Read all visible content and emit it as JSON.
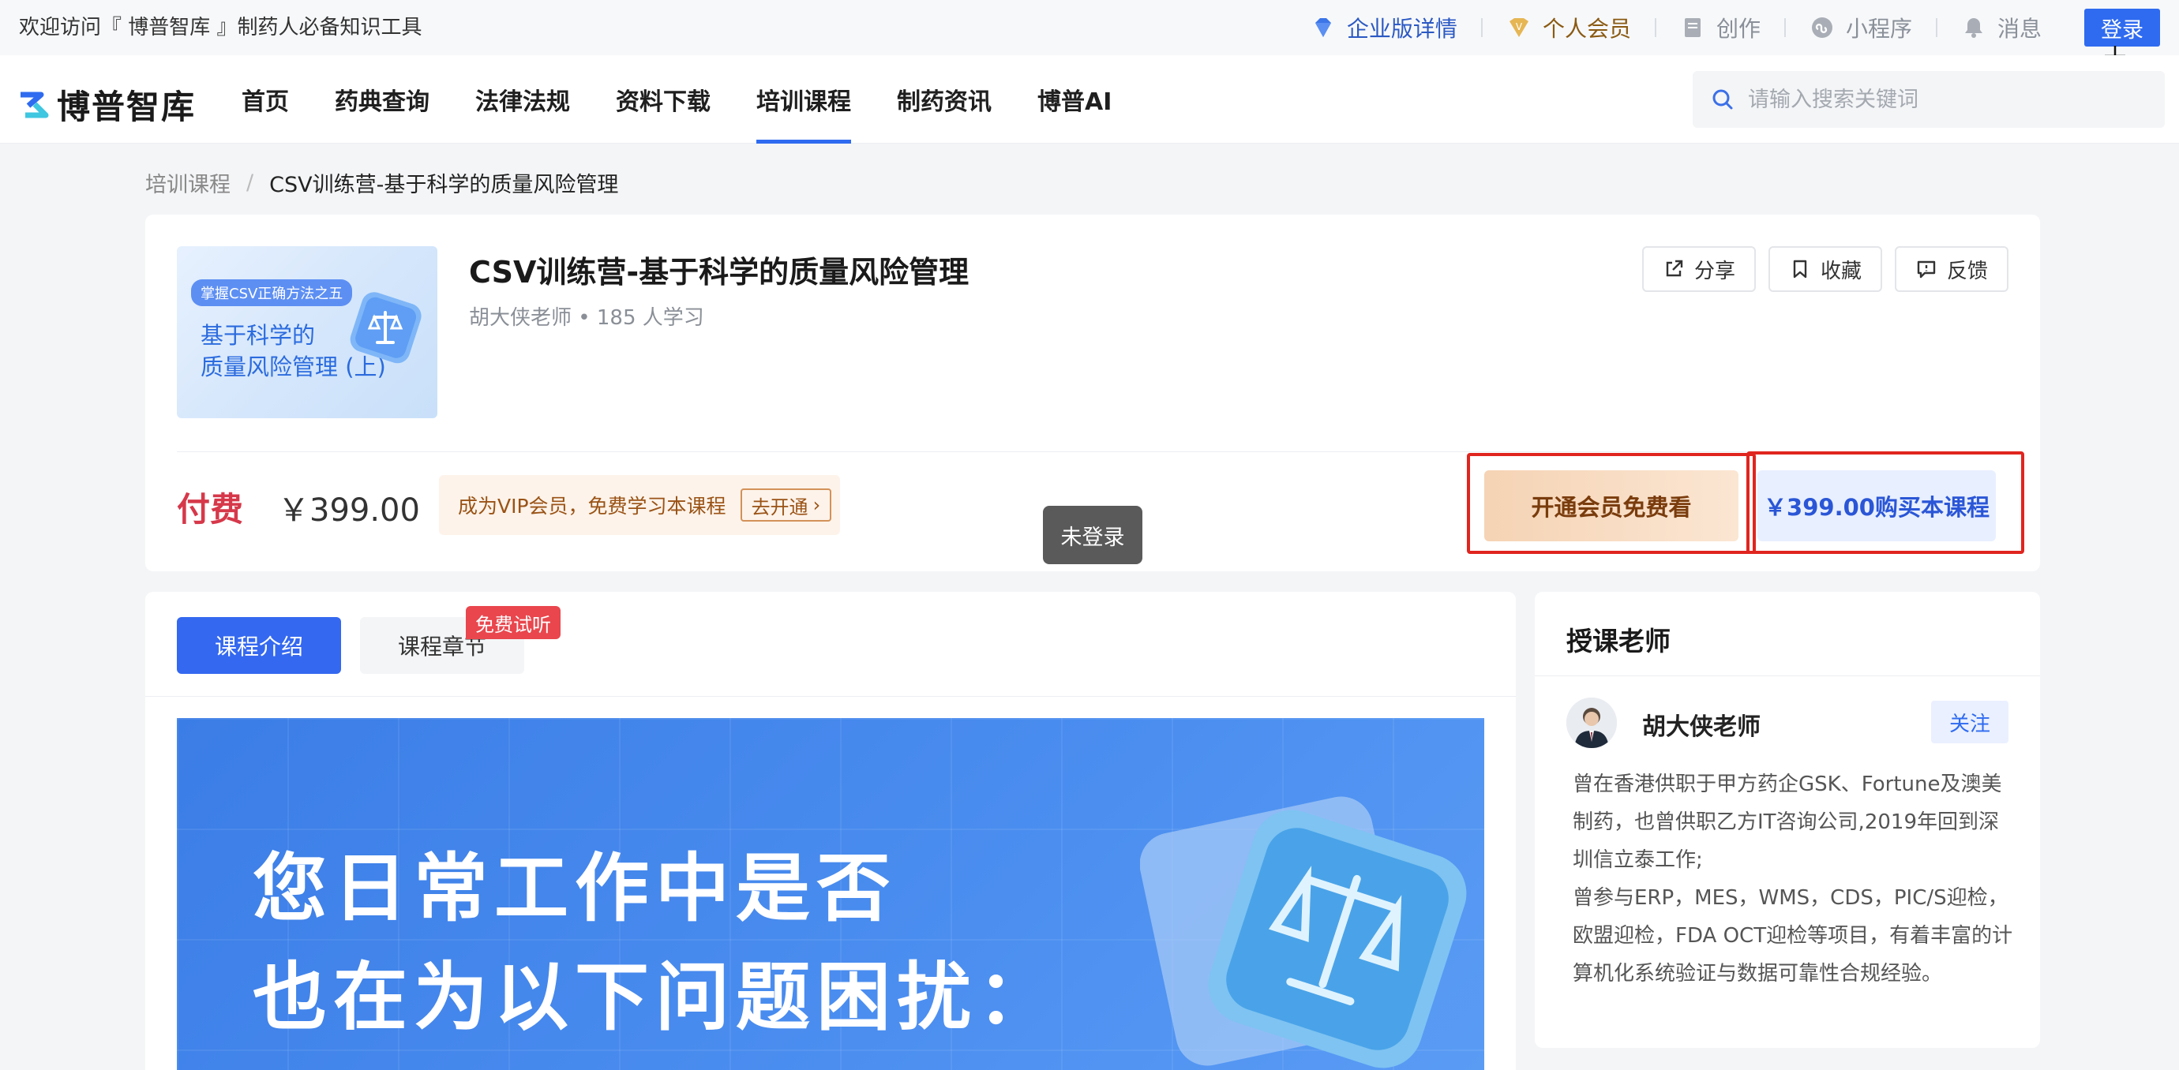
{
  "topbar": {
    "welcome": "欢迎访问『 博普智库 』制药人必备知识工具",
    "enterprise": "企业版详情",
    "member": "个人会员",
    "create": "创作",
    "miniprogram": "小程序",
    "message": "消息",
    "login": "登录"
  },
  "navbar": {
    "brand": "博普智库",
    "items": [
      "首页",
      "药典查询",
      "法律法规",
      "资料下载",
      "培训课程",
      "制药资讯",
      "博普AI"
    ],
    "active_index": 4,
    "search_placeholder": "请输入搜索关键词"
  },
  "breadcrumb": {
    "parent": "培训课程",
    "separator": "/",
    "current": "CSV训练营-基于科学的质量风险管理"
  },
  "course": {
    "thumb_tag": "掌握CSV正确方法之五",
    "thumb_line1": "基于科学的",
    "thumb_line2": "质量风险管理 (上)",
    "title": "CSV训练营-基于科学的质量风险管理",
    "meta": "胡大侠老师 • 185 人学习",
    "actions": {
      "share": "分享",
      "favorite": "收藏",
      "feedback": "反馈"
    },
    "price_label": "付费",
    "price": "￥399.00",
    "vip_promo": "成为VIP会员，免费学习本课程",
    "vip_go": "去开通",
    "btn_member": "开通会员免费看",
    "btn_buy": "￥399.00购买本课程"
  },
  "tooltip": "未登录",
  "tabs": {
    "intro": "课程介绍",
    "chapters": "课程章节",
    "free_badge": "免费试听"
  },
  "banner": {
    "line1": "您日常工作中是否",
    "line2": "也在为以下问题困扰："
  },
  "teacher": {
    "heading": "授课老师",
    "name": "胡大侠老师",
    "follow": "关注",
    "bio_p1": "曾在香港供职于甲方药企GSK、Fortune及澳美制药，也曾供职乙方IT咨询公司,2019年回到深圳信立泰工作;",
    "bio_p2": "曾参与ERP，MES，WMS，CDS，PIC/S迎检，欧盟迎检，FDA OCT迎检等项目，有着丰富的计算机化系统验证与数据可靠性合规经验。"
  },
  "colors": {
    "primary": "#2f6bf0",
    "price_red": "#d6384a",
    "highlight_red": "#e0251f",
    "badge_red": "#e9464d"
  }
}
